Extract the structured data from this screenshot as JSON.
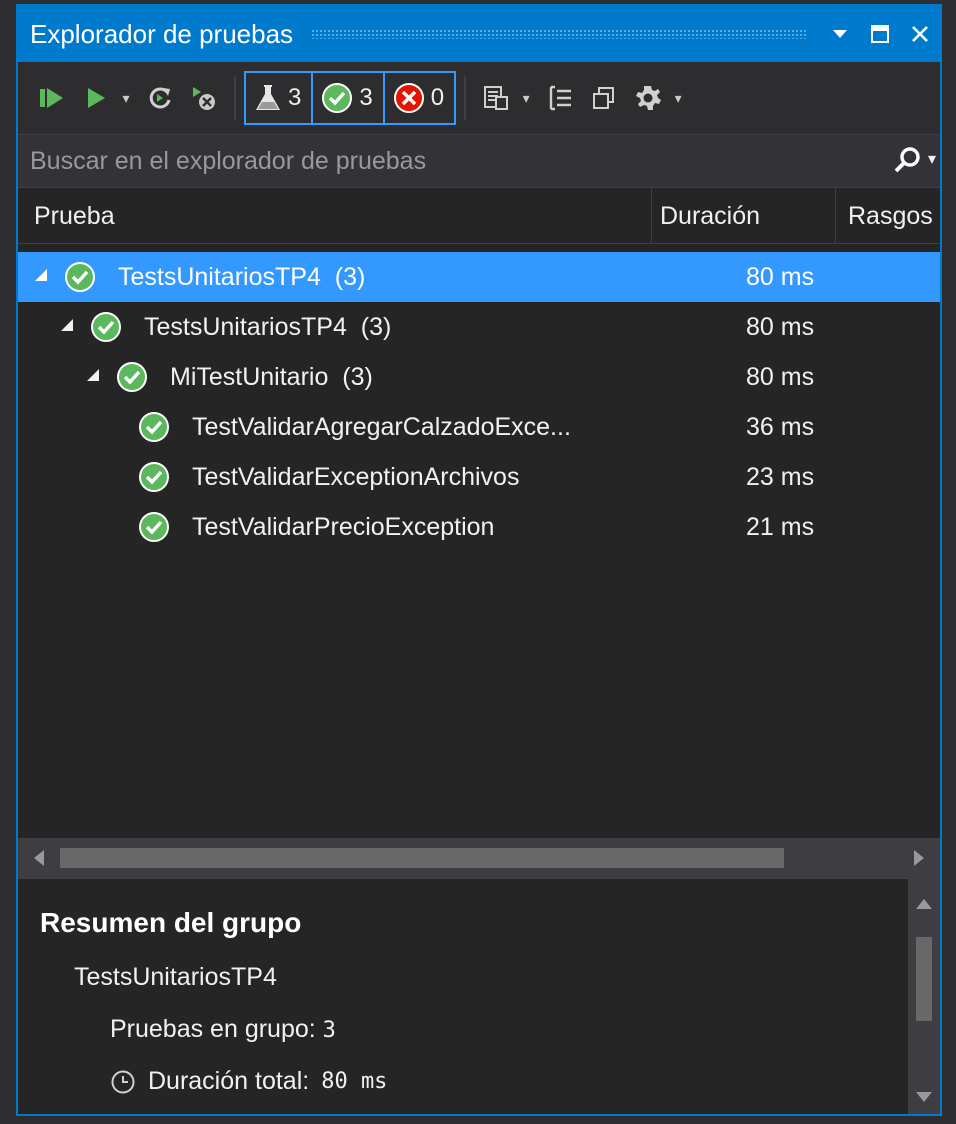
{
  "window": {
    "title": "Explorador de pruebas"
  },
  "toolbar": {
    "total_count": "3",
    "passed_count": "3",
    "failed_count": "0"
  },
  "search": {
    "placeholder": "Buscar en el explorador de pruebas"
  },
  "columns": {
    "test": "Prueba",
    "duration": "Duración",
    "traits": "Rasgos"
  },
  "tree": [
    {
      "name": "TestsUnitariosTP4",
      "count": "(3)",
      "duration": "80 ms",
      "selected": true
    },
    {
      "name": "TestsUnitariosTP4",
      "count": "(3)",
      "duration": "80 ms",
      "selected": false
    },
    {
      "name": "MiTestUnitario",
      "count": "(3)",
      "duration": "80 ms",
      "selected": false
    },
    {
      "name": "TestValidarAgregarCalzadoExce...",
      "count": "",
      "duration": "36 ms",
      "selected": false
    },
    {
      "name": "TestValidarExceptionArchivos",
      "count": "",
      "duration": "23 ms",
      "selected": false
    },
    {
      "name": "TestValidarPrecioException",
      "count": "",
      "duration": "21 ms",
      "selected": false
    }
  ],
  "summary": {
    "heading": "Resumen del grupo",
    "group_name": "TestsUnitariosTP4",
    "tests_label": "Pruebas en grupo:",
    "tests_value": "3",
    "duration_label": "Duración total:",
    "duration_value": "80 ms"
  },
  "colors": {
    "accent": "#007acc",
    "selection": "#3399ff",
    "pass": "#5cb85c",
    "fail": "#e51400"
  }
}
